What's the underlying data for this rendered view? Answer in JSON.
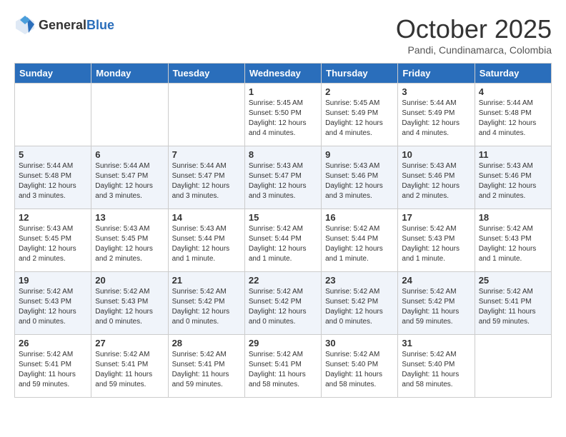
{
  "header": {
    "logo_general": "General",
    "logo_blue": "Blue",
    "month": "October 2025",
    "location": "Pandi, Cundinamarca, Colombia"
  },
  "days_of_week": [
    "Sunday",
    "Monday",
    "Tuesday",
    "Wednesday",
    "Thursday",
    "Friday",
    "Saturday"
  ],
  "weeks": [
    [
      {
        "day": "",
        "info": ""
      },
      {
        "day": "",
        "info": ""
      },
      {
        "day": "",
        "info": ""
      },
      {
        "day": "1",
        "info": "Sunrise: 5:45 AM\nSunset: 5:50 PM\nDaylight: 12 hours\nand 4 minutes."
      },
      {
        "day": "2",
        "info": "Sunrise: 5:45 AM\nSunset: 5:49 PM\nDaylight: 12 hours\nand 4 minutes."
      },
      {
        "day": "3",
        "info": "Sunrise: 5:44 AM\nSunset: 5:49 PM\nDaylight: 12 hours\nand 4 minutes."
      },
      {
        "day": "4",
        "info": "Sunrise: 5:44 AM\nSunset: 5:48 PM\nDaylight: 12 hours\nand 4 minutes."
      }
    ],
    [
      {
        "day": "5",
        "info": "Sunrise: 5:44 AM\nSunset: 5:48 PM\nDaylight: 12 hours\nand 3 minutes."
      },
      {
        "day": "6",
        "info": "Sunrise: 5:44 AM\nSunset: 5:47 PM\nDaylight: 12 hours\nand 3 minutes."
      },
      {
        "day": "7",
        "info": "Sunrise: 5:44 AM\nSunset: 5:47 PM\nDaylight: 12 hours\nand 3 minutes."
      },
      {
        "day": "8",
        "info": "Sunrise: 5:43 AM\nSunset: 5:47 PM\nDaylight: 12 hours\nand 3 minutes."
      },
      {
        "day": "9",
        "info": "Sunrise: 5:43 AM\nSunset: 5:46 PM\nDaylight: 12 hours\nand 3 minutes."
      },
      {
        "day": "10",
        "info": "Sunrise: 5:43 AM\nSunset: 5:46 PM\nDaylight: 12 hours\nand 2 minutes."
      },
      {
        "day": "11",
        "info": "Sunrise: 5:43 AM\nSunset: 5:46 PM\nDaylight: 12 hours\nand 2 minutes."
      }
    ],
    [
      {
        "day": "12",
        "info": "Sunrise: 5:43 AM\nSunset: 5:45 PM\nDaylight: 12 hours\nand 2 minutes."
      },
      {
        "day": "13",
        "info": "Sunrise: 5:43 AM\nSunset: 5:45 PM\nDaylight: 12 hours\nand 2 minutes."
      },
      {
        "day": "14",
        "info": "Sunrise: 5:43 AM\nSunset: 5:44 PM\nDaylight: 12 hours\nand 1 minute."
      },
      {
        "day": "15",
        "info": "Sunrise: 5:42 AM\nSunset: 5:44 PM\nDaylight: 12 hours\nand 1 minute."
      },
      {
        "day": "16",
        "info": "Sunrise: 5:42 AM\nSunset: 5:44 PM\nDaylight: 12 hours\nand 1 minute."
      },
      {
        "day": "17",
        "info": "Sunrise: 5:42 AM\nSunset: 5:43 PM\nDaylight: 12 hours\nand 1 minute."
      },
      {
        "day": "18",
        "info": "Sunrise: 5:42 AM\nSunset: 5:43 PM\nDaylight: 12 hours\nand 1 minute."
      }
    ],
    [
      {
        "day": "19",
        "info": "Sunrise: 5:42 AM\nSunset: 5:43 PM\nDaylight: 12 hours\nand 0 minutes."
      },
      {
        "day": "20",
        "info": "Sunrise: 5:42 AM\nSunset: 5:43 PM\nDaylight: 12 hours\nand 0 minutes."
      },
      {
        "day": "21",
        "info": "Sunrise: 5:42 AM\nSunset: 5:42 PM\nDaylight: 12 hours\nand 0 minutes."
      },
      {
        "day": "22",
        "info": "Sunrise: 5:42 AM\nSunset: 5:42 PM\nDaylight: 12 hours\nand 0 minutes."
      },
      {
        "day": "23",
        "info": "Sunrise: 5:42 AM\nSunset: 5:42 PM\nDaylight: 12 hours\nand 0 minutes."
      },
      {
        "day": "24",
        "info": "Sunrise: 5:42 AM\nSunset: 5:42 PM\nDaylight: 11 hours\nand 59 minutes."
      },
      {
        "day": "25",
        "info": "Sunrise: 5:42 AM\nSunset: 5:41 PM\nDaylight: 11 hours\nand 59 minutes."
      }
    ],
    [
      {
        "day": "26",
        "info": "Sunrise: 5:42 AM\nSunset: 5:41 PM\nDaylight: 11 hours\nand 59 minutes."
      },
      {
        "day": "27",
        "info": "Sunrise: 5:42 AM\nSunset: 5:41 PM\nDaylight: 11 hours\nand 59 minutes."
      },
      {
        "day": "28",
        "info": "Sunrise: 5:42 AM\nSunset: 5:41 PM\nDaylight: 11 hours\nand 59 minutes."
      },
      {
        "day": "29",
        "info": "Sunrise: 5:42 AM\nSunset: 5:41 PM\nDaylight: 11 hours\nand 58 minutes."
      },
      {
        "day": "30",
        "info": "Sunrise: 5:42 AM\nSunset: 5:40 PM\nDaylight: 11 hours\nand 58 minutes."
      },
      {
        "day": "31",
        "info": "Sunrise: 5:42 AM\nSunset: 5:40 PM\nDaylight: 11 hours\nand 58 minutes."
      },
      {
        "day": "",
        "info": ""
      }
    ]
  ]
}
